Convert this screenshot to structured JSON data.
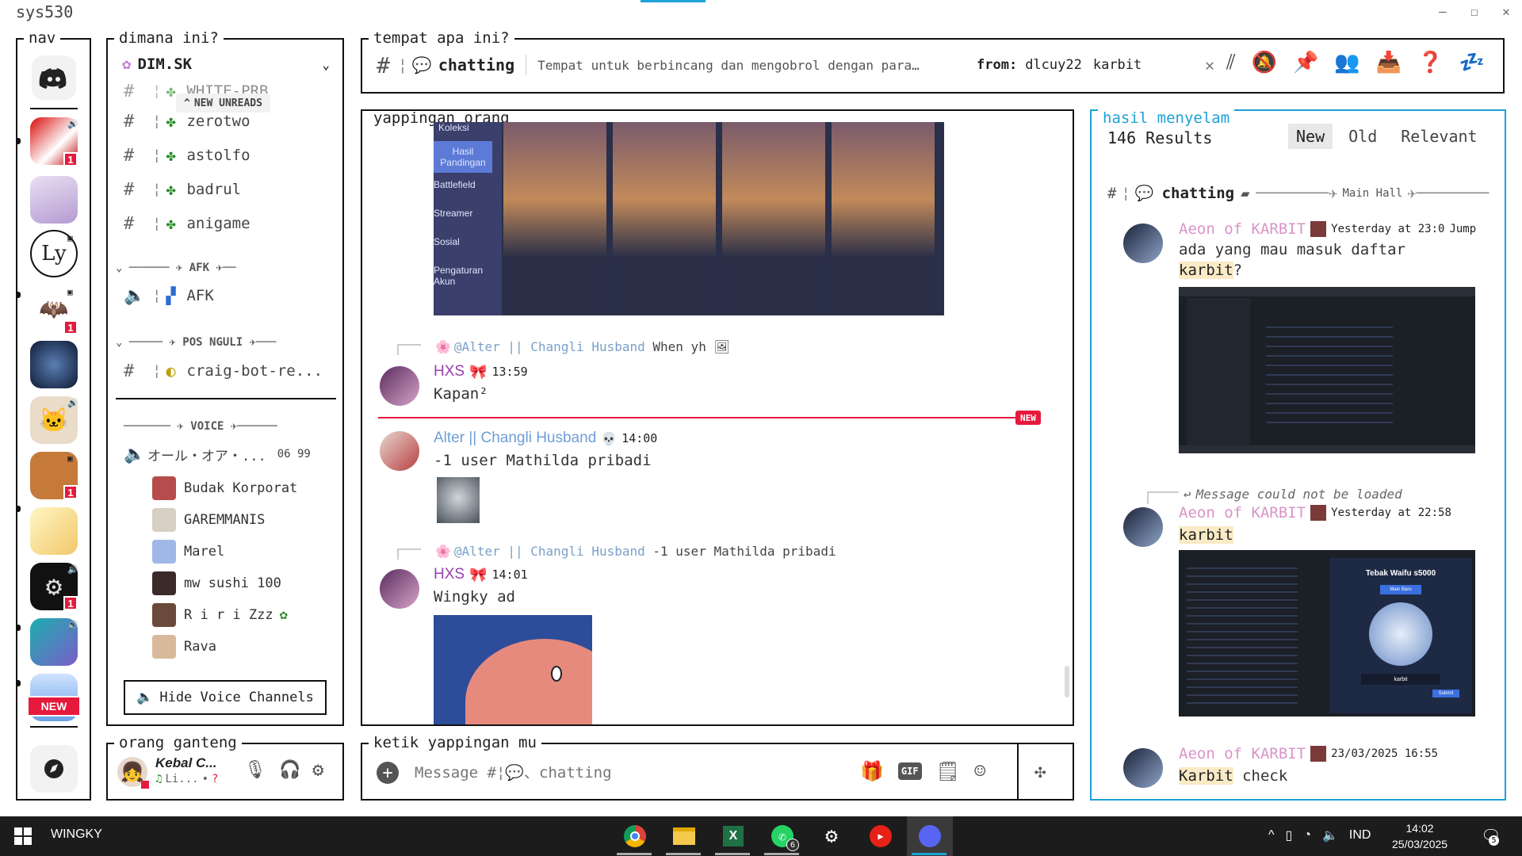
{
  "window": {
    "title": "sys530"
  },
  "nav": {
    "title": "nav",
    "badges": [
      "1",
      "1",
      "1",
      "1",
      "1"
    ],
    "new_badge": "NEW"
  },
  "channels": {
    "title": "dimana ini?",
    "server": "DIM.SK",
    "new_unreads": "NEW UNREADS",
    "truncated_top": "WHITE-PRB",
    "items": [
      "zerotwo",
      "astolfo",
      "badrul",
      "anigame"
    ],
    "cat_afk": "AFK",
    "afk_channel": "AFK",
    "cat_posnguli": "POS NGULI",
    "craig_channel": "craig-bot-re...",
    "cat_voice": "VOICE",
    "voice_channel": "オール・オア・...",
    "voice_count": "06 99",
    "voice_users": [
      "Budak Korporat",
      "GAREMMANIS",
      "Marel",
      "mw sushi 100",
      "R i r i Zzz",
      "Rava"
    ],
    "hide_voice": "Hide Voice Channels"
  },
  "header": {
    "title": "tempat apa ini?",
    "channel": "chatting",
    "topic": "Tempat untuk berbincang dan mengobrol dengan para…",
    "search_from": "from:",
    "search_user": "dlcuy22",
    "search_term": "karbit"
  },
  "chat": {
    "title": "yappingan orang",
    "game_labels": [
      "Koleksi",
      "Hasil Pandingan",
      "Battlefield",
      "Streamer",
      "Sosial",
      "Pengaturan Akun"
    ],
    "m1_reply_name": "@Alter || Changli Husband",
    "m1_reply_text": "When yh",
    "m1_user": "HXS",
    "m1_time": "13:59",
    "m1_text": "Kapan²",
    "new_divider": "NEW",
    "m2_user": "Alter || Changli Husband",
    "m2_time": "14:00",
    "m2_text": "-1 user Mathilda pribadi",
    "m3_reply_name": "@Alter || Changli Husband",
    "m3_reply_text": "-1 user Mathilda pribadi",
    "m3_user": "HXS",
    "m3_time": "14:01",
    "m3_text": "Wingky ad"
  },
  "user": {
    "title": "orang ganteng",
    "name": "Kebal C...",
    "status": "Li..."
  },
  "composer": {
    "title": "ketik yappingan mu",
    "placeholder": "Message #¦💬、chatting",
    "gif": "GIF"
  },
  "results": {
    "title": "hasil menyelam",
    "count": "146 Results",
    "tabs": [
      "New",
      "Old",
      "Relevant"
    ],
    "channel": "chatting",
    "thread": "Main Hall",
    "r1_user": "Aeon of KARBIT",
    "r1_time": "Yesterday at 23:0",
    "r1_jump": "Jump",
    "r1_text_a": "ada yang mau masuk daftar",
    "r1_text_hl": "karbit",
    "r1_text_b": "?",
    "r2_reply": "Message could not be loaded",
    "r2_user": "Aeon of KARBIT",
    "r2_time": "Yesterday at 22:58",
    "r2_text": "karbit",
    "r2_game_title": "Tebak Waifu s5000",
    "r2_game_btn": "Main Baru",
    "r2_game_input": "karbit",
    "r2_game_submit": "Submit",
    "r3_user": "Aeon of KARBIT",
    "r3_time": "23/03/2025 16:55",
    "r3_text_hl": "Karbit",
    "r3_text_b": "check"
  },
  "taskbar": {
    "user": "WINGKY",
    "whatsapp_badge": "6",
    "lang": "IND",
    "time": "14:02",
    "date": "25/03/2025",
    "notif": "5"
  },
  "colors": {
    "accent_blue": "#1da1d6",
    "alter_blue": "#6f9ed6",
    "purple": "#9a3fb0",
    "aeon": "#d995c8",
    "new_red": "#e6193c"
  }
}
